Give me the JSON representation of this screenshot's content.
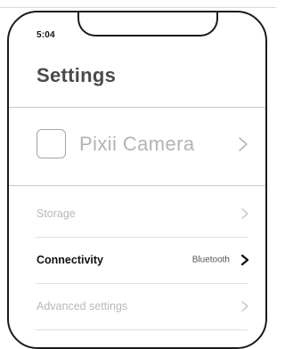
{
  "status_bar": {
    "time": "5:04"
  },
  "header": {
    "title": "Settings"
  },
  "device": {
    "name": "Pixii Camera",
    "chevron_icon": "chevron-right-icon"
  },
  "settings_rows": [
    {
      "label": "Storage",
      "value": "",
      "state": "disabled",
      "chevron_icon": "chevron-right-icon"
    },
    {
      "label": "Connectivity",
      "value": "Bluetooth",
      "state": "enabled",
      "chevron_icon": "chevron-right-icon"
    },
    {
      "label": "Advanced settings",
      "value": "",
      "state": "disabled",
      "chevron_icon": "chevron-right-icon"
    }
  ],
  "colors": {
    "frame": "#1a1a1a",
    "text_primary": "#111111",
    "text_disabled": "#b8b8b8",
    "title": "#4a4a4a"
  }
}
